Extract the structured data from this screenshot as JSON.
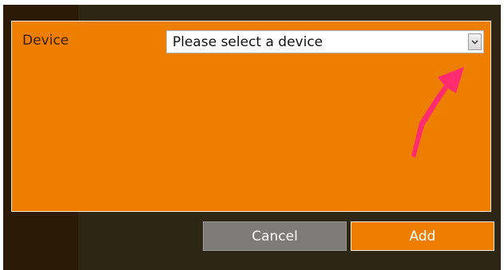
{
  "dialog": {
    "device_label": "Device",
    "device_select": {
      "selected": "Please select a device",
      "icon": "chevron-down-icon"
    }
  },
  "buttons": {
    "cancel_label": "Cancel",
    "add_label": "Add"
  },
  "colors": {
    "accent": "#ee7e00",
    "background_dark": "#2e2614",
    "left_strip": "#2a1a06",
    "cancel_button": "#7d7a78",
    "annotation_arrow": "#ff2d6f"
  },
  "annotation": {
    "icon": "pointer-arrow-icon"
  }
}
